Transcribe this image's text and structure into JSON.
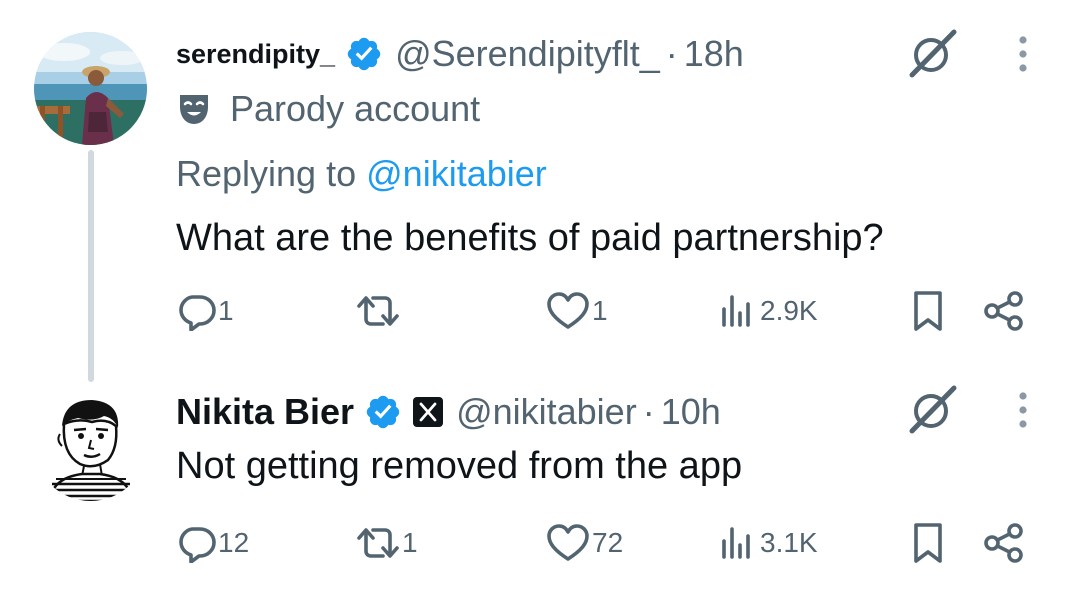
{
  "colors": {
    "text": "#0f1419",
    "secondary": "#536471",
    "accent": "#1d9bf0",
    "thread_line": "#cfd9de"
  },
  "tweets": [
    {
      "display_name": "serendipity_",
      "handle": "@Serendipityflt_",
      "separator": "·",
      "time": "18h",
      "parody_label": "Parody account",
      "replying_prefix": "Replying to",
      "replying_handle": "@nikitabier",
      "text": "What are the benefits of paid partnership?",
      "replies": "1",
      "reposts": "",
      "likes": "1",
      "views": "2.9K",
      "icons": [
        "verified-icon",
        "grok-icon",
        "more-icon",
        "parody-mask-icon",
        "reply-icon",
        "repost-icon",
        "like-icon",
        "views-icon",
        "bookmark-icon",
        "share-icon"
      ]
    },
    {
      "display_name": "Nikita Bier",
      "handle": "@nikitabier",
      "separator": "·",
      "time": "10h",
      "text": "Not getting removed from the app",
      "replies": "12",
      "reposts": "1",
      "likes": "72",
      "views": "3.1K",
      "icons": [
        "verified-icon",
        "x-affiliate-icon",
        "grok-icon",
        "more-icon",
        "reply-icon",
        "repost-icon",
        "like-icon",
        "views-icon",
        "bookmark-icon",
        "share-icon"
      ]
    }
  ]
}
